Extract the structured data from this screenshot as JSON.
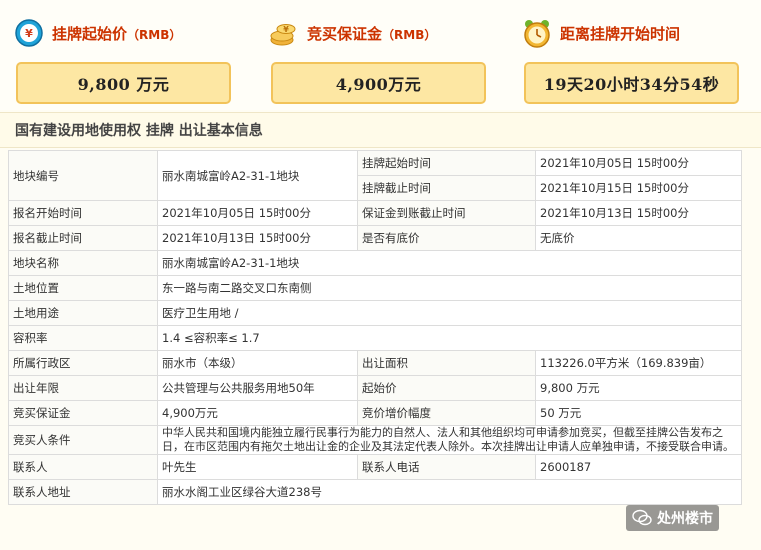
{
  "summary": {
    "start_price": {
      "label": "挂牌起始价",
      "unit": "（RMB）",
      "value": "9,800  万元",
      "icon": "clock-price-icon"
    },
    "deposit": {
      "label": "竞买保证金",
      "unit": "（RMB）",
      "value": "4,900万元",
      "icon": "coins-icon"
    },
    "countdown": {
      "label": "距离挂牌开始时间",
      "value": "19天20小时34分54秒",
      "icon": "alarm-clock-icon"
    }
  },
  "section": {
    "title": "国有建设用地使用权  挂牌  出让基本信息"
  },
  "table": {
    "plot_no_label": "地块编号",
    "plot_no": "丽水南城富岭A2-31-1地块",
    "listing_start_label": "挂牌起始时间",
    "listing_start": "2021年10月05日  15时00分",
    "listing_end_label": "挂牌截止时间",
    "listing_end": "2021年10月15日  15时00分",
    "signup_start_label": "报名开始时间",
    "signup_start": "2021年10月05日  15时00分",
    "deposit_deadline_label": "保证金到账截止时间",
    "deposit_deadline": "2021年10月13日  15时00分",
    "signup_end_label": "报名截止时间",
    "signup_end": "2021年10月13日  15时00分",
    "reserve_label": "是否有底价",
    "reserve": "无底价",
    "plot_name_label": "地块名称",
    "plot_name": "丽水南城富岭A2-31-1地块",
    "location_label": "土地位置",
    "location": "东一路与南二路交叉口东南侧",
    "usage_label": "土地用途",
    "usage": "医疗卫生用地  /",
    "far_label": "容积率",
    "far": "1.4  ≤容积率≤  1.7",
    "district_label": "所属行政区",
    "district": "丽水市（本级）",
    "area_label": "出让面积",
    "area": "113226.0平方米（169.839亩）",
    "term_label": "出让年限",
    "term": "公共管理与公共服务用地50年",
    "start_price_label": "起始价",
    "start_price": "9,800  万元",
    "deposit_label": "竞买保证金",
    "deposit": "4,900万元",
    "increment_label": "竞价增价幅度",
    "increment": "50  万元",
    "bidder_label": "竞买人条件",
    "bidder": "中华人民共和国境内能独立履行民事行为能力的自然人、法人和其他组织均可申请参加竞买，但截至挂牌公告发布之日，在市区范围内有拖欠土地出让金的企业及其法定代表人除外。本次挂牌出让申请人应单独申请，不接受联合申请。",
    "contact_label": "联系人",
    "contact": "叶先生",
    "phone_label": "联系人电话",
    "phone": "2600187",
    "address_label": "联系人地址",
    "address": "丽水水阁工业区绿谷大道238号"
  },
  "watermark": {
    "text": "处州楼市",
    "icon": "wechat-icon"
  }
}
